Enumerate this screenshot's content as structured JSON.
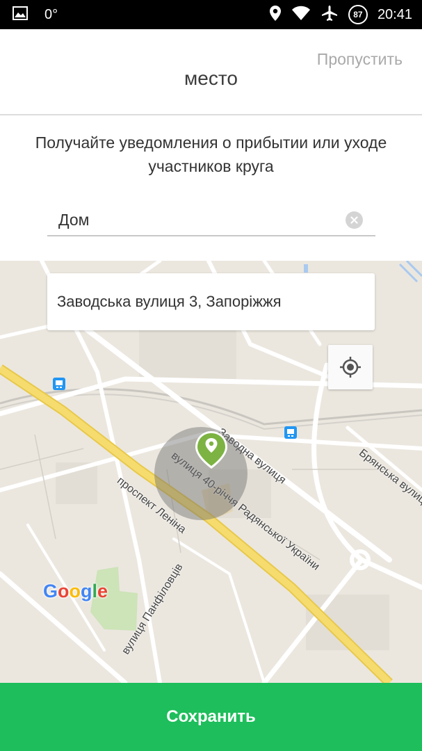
{
  "status_bar": {
    "temperature": "0",
    "degree": "°",
    "battery": "87",
    "time": "20:41"
  },
  "header": {
    "skip_label": "Пропустить",
    "title": "место"
  },
  "subtitle": "Получайте уведомления о прибытии или уходе участников круга",
  "place_name": {
    "value": "Дом"
  },
  "map": {
    "address": "Заводська вулиця 3, Запоріжжя",
    "google_letters": [
      "G",
      "o",
      "o",
      "g",
      "l",
      "e"
    ],
    "google_colors": [
      "#4285F4",
      "#EA4335",
      "#FBBC05",
      "#4285F4",
      "#34A853",
      "#EA4335"
    ],
    "streets": {
      "lenina": "проспект Леніна",
      "sorok_richa": "вулиця 40-річчя Радянської України",
      "zavodska": "Заводна вулиця",
      "bryanska": "Брянська вулиця",
      "panfilovtsiv": "вулиця Панфіловців"
    },
    "accent_color": "#7cb342"
  },
  "save_button": {
    "label": "Сохранить",
    "color": "#1dbe5b"
  }
}
